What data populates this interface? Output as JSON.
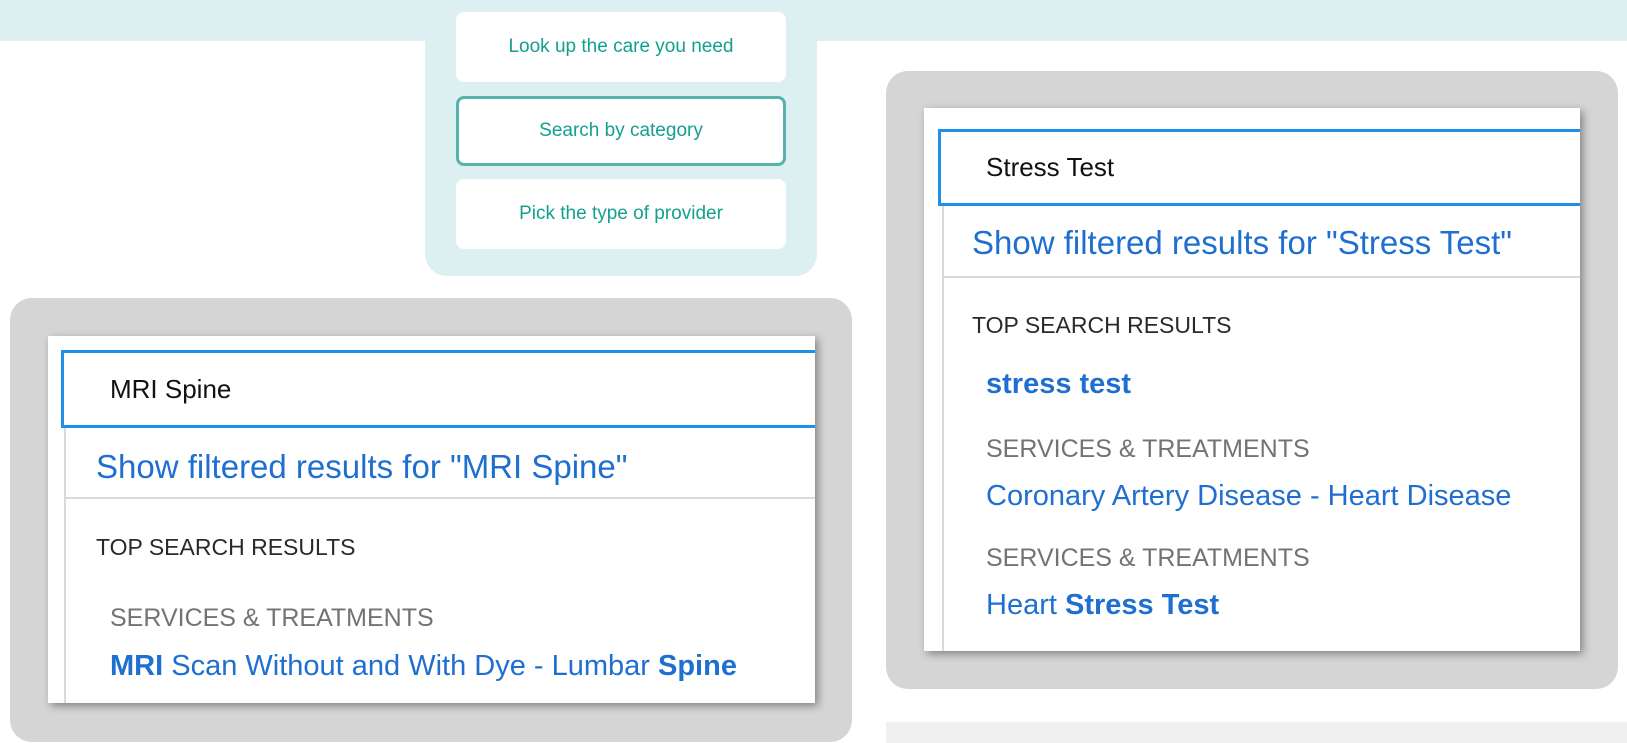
{
  "options": {
    "items": [
      {
        "label": "Look up the care you need"
      },
      {
        "label": "Search by category"
      },
      {
        "label": "Pick the type of provider"
      }
    ],
    "active_index": 1
  },
  "left_example": {
    "search_value": "MRI Spine",
    "filter_link": "Show filtered results for \"MRI Spine\"",
    "section_heading": "TOP SEARCH RESULTS",
    "category_label": "SERVICES & TREATMENTS",
    "result": {
      "bold1": "MRI",
      "middle": " Scan Without and With Dye - Lumbar ",
      "bold2": "Spine"
    }
  },
  "right_example": {
    "search_value": "Stress Test",
    "filter_link": "Show filtered results for \"Stress Test\"",
    "section_heading": "TOP SEARCH RESULTS",
    "result1": "stress test",
    "category1": "SERVICES & TREATMENTS",
    "result2": "Coronary Artery Disease - Heart Disease",
    "category2": "SERVICES & TREATMENTS",
    "result3": {
      "plain": "Heart ",
      "bold": "Stress Test"
    }
  },
  "colors": {
    "teal_band": "#dcf0f1",
    "teal_text": "#13a090",
    "active_border": "#58b2ac",
    "link_blue": "#1f6fd0",
    "input_border": "#1e90e8",
    "panel_gray": "#d5d5d5"
  }
}
